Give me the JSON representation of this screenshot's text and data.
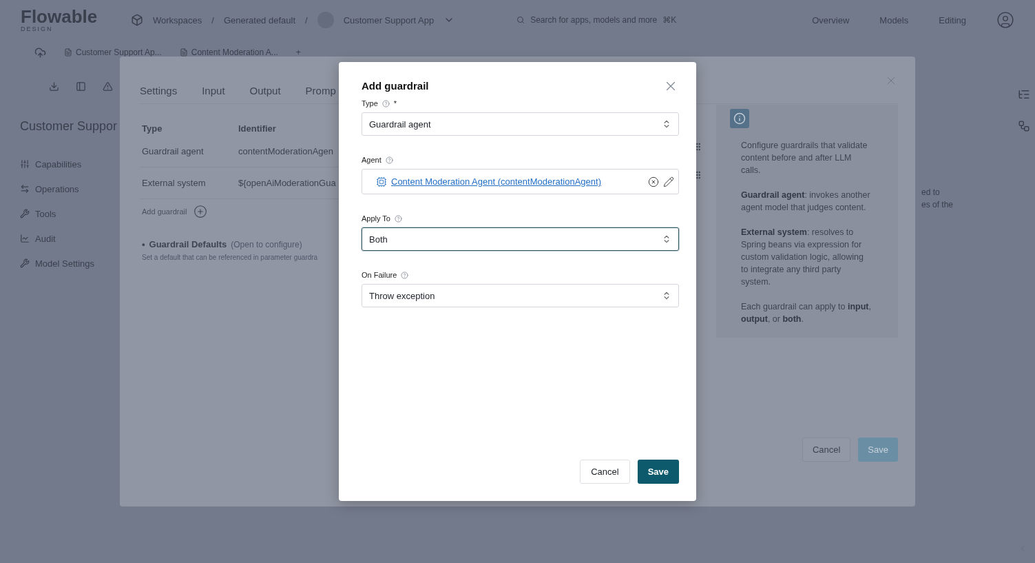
{
  "app_header": {
    "logo": "Flowable",
    "logo_sub": "DESIGN",
    "breadcrumbs": [
      "Workspaces",
      "Generated default",
      "Customer Support App"
    ],
    "separator": "/",
    "search": {
      "placeholder": "Search for apps, models and more",
      "shortcut": "⌘K"
    },
    "nav": [
      "Overview",
      "Models",
      "Editing"
    ]
  },
  "editor_tabs": [
    "Customer Support Ap...",
    "Content Moderation A...",
    "+"
  ],
  "sidebar": {
    "title": "Customer Suppor",
    "items": [
      {
        "label": "Capabilities",
        "kind": "sliders"
      },
      {
        "label": "Operations",
        "kind": "arrows"
      },
      {
        "label": "Tools",
        "kind": "wrench"
      },
      {
        "label": "Audit",
        "kind": "chart"
      },
      {
        "label": "Model Settings",
        "kind": "wrench"
      }
    ]
  },
  "side_fragments": [
    "ed to",
    "es of the"
  ],
  "settings_dialog": {
    "tabs": [
      "Settings",
      "Input",
      "Output",
      "Promp"
    ],
    "table": {
      "columns": [
        "Type",
        "Identifier"
      ],
      "rows": [
        [
          "Guardrail agent",
          "contentModerationAgen"
        ],
        [
          "External system",
          "${openAiModerationGua"
        ]
      ]
    },
    "add_label": "Add guardrail",
    "defaults": {
      "bullet": "•",
      "title": "Guardrail Defaults",
      "hint": "(Open to configure)",
      "description": "Set a default that can be referenced in parameter guardra"
    },
    "info": [
      "Configure guardrails that validate content before and after LLM calls.",
      "**Guardrail agent**: invokes another agent model that judges content.",
      "**External system**: resolves to Spring beans via expression for custom validation logic, allowing to integrate any third party system.",
      "Each guardrail can apply to **input**, **output**, or **both**."
    ],
    "buttons": [
      "Cancel",
      "Save"
    ]
  },
  "modal": {
    "title": "Add guardrail",
    "fields": [
      {
        "label": "Type",
        "required_mark": "*",
        "kind": "select",
        "value": "Guardrail agent",
        "focused": false
      },
      {
        "label": "Agent",
        "kind": "link",
        "value": "Content Moderation Agent (contentModerationAgent)",
        "focused": false
      },
      {
        "label": "Apply To",
        "kind": "select",
        "value": "Both",
        "focused": true
      },
      {
        "label": "On Failure",
        "kind": "select",
        "value": "Throw exception",
        "focused": false
      }
    ],
    "buttons": [
      "Cancel",
      "Save"
    ]
  }
}
